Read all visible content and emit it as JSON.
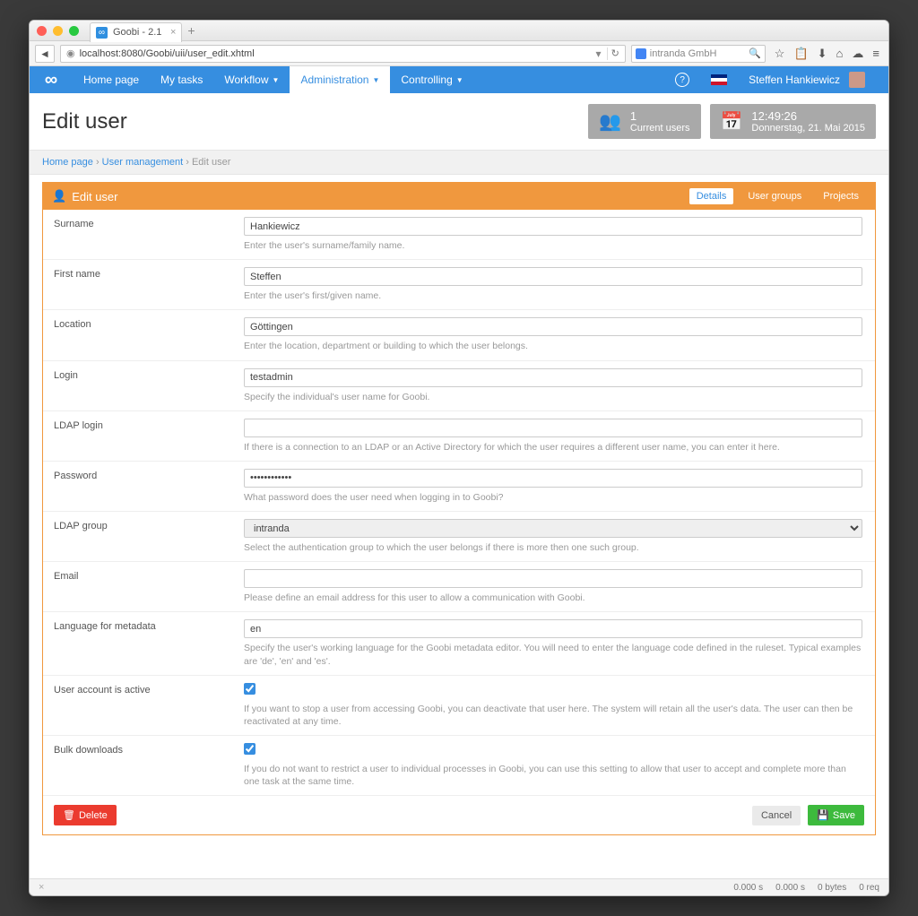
{
  "browser": {
    "tab_title": "Goobi - 2.1",
    "url": "localhost:8080/Goobi/uii/user_edit.xhtml",
    "search_placeholder": "intranda GmbH"
  },
  "nav": {
    "items": [
      "Home page",
      "My tasks",
      "Workflow",
      "Administration",
      "Controlling"
    ],
    "active": "Administration",
    "user": "Steffen Hankiewicz",
    "logo": "∞"
  },
  "page": {
    "title": "Edit user",
    "card_users": {
      "count": "1",
      "label": "Current users"
    },
    "card_time": {
      "time": "12:49:26",
      "date": "Donnerstag, 21. Mai 2015"
    }
  },
  "breadcrumb": {
    "items": [
      "Home page",
      "User management",
      "Edit user"
    ],
    "sep": "›"
  },
  "panel": {
    "title": "Edit user",
    "tabs": [
      "Details",
      "User groups",
      "Projects"
    ],
    "active_tab": "Details"
  },
  "form": {
    "surname": {
      "label": "Surname",
      "value": "Hankiewicz",
      "help": "Enter the user's surname/family name."
    },
    "firstname": {
      "label": "First name",
      "value": "Steffen",
      "help": "Enter the user's first/given name."
    },
    "location": {
      "label": "Location",
      "value": "Göttingen",
      "help": "Enter the location, department or building to which the user belongs."
    },
    "login": {
      "label": "Login",
      "value": "testadmin",
      "help": "Specify the individual's user name for Goobi."
    },
    "ldap_login": {
      "label": "LDAP login",
      "value": "",
      "help": "If there is a connection to an LDAP or an Active Directory for which the user requires a different user name, you can enter it here."
    },
    "password": {
      "label": "Password",
      "value": "••••••••••••",
      "help": "What password does the user need when logging in to Goobi?"
    },
    "ldap_group": {
      "label": "LDAP group",
      "value": "intranda",
      "help": "Select the authentication group to which the user belongs if there is more then one such group."
    },
    "email": {
      "label": "Email",
      "value": "",
      "help": "Please define an email address for this user to allow a communication with Goobi."
    },
    "language": {
      "label": "Language for metadata",
      "value": "en",
      "help": "Specify the user's working language for the Goobi metadata editor. You will need to enter the language code defined in the ruleset. Typical examples are 'de', 'en' and 'es'."
    },
    "active": {
      "label": "User account is active",
      "checked": true,
      "help": "If you want to stop a user from accessing Goobi, you can deactivate that user here. The system will retain all the user's data. The user can then be reactivated at any time."
    },
    "bulk": {
      "label": "Bulk downloads",
      "checked": true,
      "help": "If you do not want to restrict a user to individual processes in Goobi, you can use this setting to allow that user to accept and complete more than one task at the same time."
    }
  },
  "actions": {
    "delete": "Delete",
    "cancel": "Cancel",
    "save": "Save"
  },
  "status": {
    "s1": "0.000 s",
    "s2": "0.000 s",
    "s3": "0 bytes",
    "s4": "0 req"
  }
}
